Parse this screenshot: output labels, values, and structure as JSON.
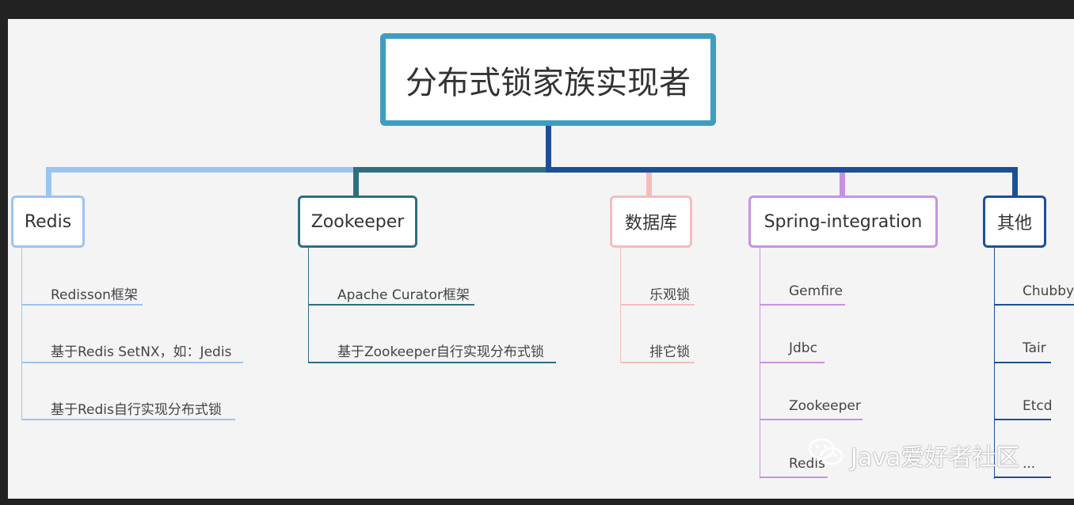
{
  "root": {
    "label": "分布式锁家族实现者"
  },
  "colors": {
    "root": "#3e9ec1",
    "redis": "#9cc4f0",
    "zookeeper": "#2e6f82",
    "database": "#f6bcbc",
    "spring": "#c792e4",
    "others": "#1d4f97",
    "trunk": "#1d4f97"
  },
  "categories": [
    {
      "key": "redis",
      "label": "Redis",
      "items": [
        "Redisson框架",
        "基于Redis SetNX，如：Jedis",
        "基于Redis自行实现分布式锁"
      ]
    },
    {
      "key": "zookeeper",
      "label": "Zookeeper",
      "items": [
        "Apache Curator框架",
        "基于Zookeeper自行实现分布式锁"
      ]
    },
    {
      "key": "database",
      "label": "数据库",
      "items": [
        "乐观锁",
        "排它锁"
      ]
    },
    {
      "key": "spring",
      "label": "Spring-integration",
      "items": [
        "Gemfire",
        "Jdbc",
        "Zookeeper",
        "Redis"
      ]
    },
    {
      "key": "others",
      "label": "其他",
      "items": [
        "Chubby",
        "Tair",
        "Etcd",
        "..."
      ]
    }
  ],
  "watermark": {
    "icon": "wechat-icon",
    "text": "Java爱好者社区"
  }
}
